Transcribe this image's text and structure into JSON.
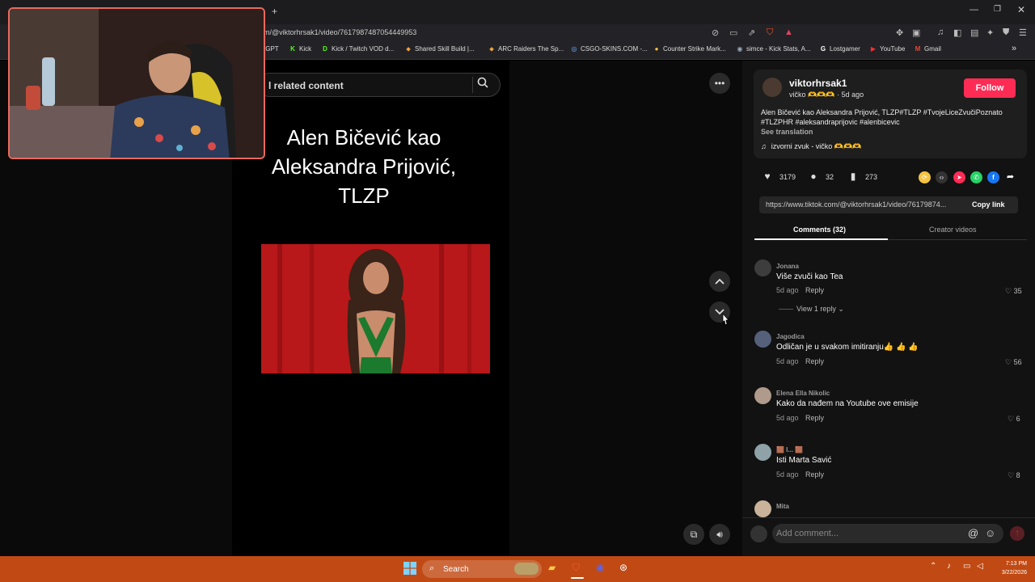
{
  "browser": {
    "new_tab_label": "+",
    "url": "m/@viktorhrsak1/video/7617987487054449953",
    "bookmarks": [
      {
        "label": "tGPT",
        "icon": ""
      },
      {
        "label": "Kick",
        "icon": "K"
      },
      {
        "label": "Kick / Twitch VOD d...",
        "icon": "D"
      },
      {
        "label": "Shared Skill Build |...",
        "icon": "⬥"
      },
      {
        "label": "ARC Raiders The Sp...",
        "icon": "⬥"
      },
      {
        "label": "CSGO-SKINS.COM -...",
        "icon": "◎"
      },
      {
        "label": "Counter Strike Mark...",
        "icon": "●"
      },
      {
        "label": "simce - Kick Stats, A...",
        "icon": "◉"
      },
      {
        "label": "Lostgamer",
        "icon": "G"
      },
      {
        "label": "YouTube",
        "icon": "▶"
      },
      {
        "label": "Gmail",
        "icon": "M"
      }
    ],
    "more_bookmarks": "»"
  },
  "search": {
    "text": "l related content"
  },
  "video": {
    "title": "Alen Bičević kao Aleksandra Prijović, TLZP"
  },
  "post": {
    "username": "viktorhrsak1",
    "display_name": "vičko 🫶🫶🫶",
    "time": "· 5d ago",
    "follow_label": "Follow",
    "caption": "Alen Bičević kao Aleksandra Prijović, TLZP#TLZP #TvojeLiceZvučiPoznato #TLZPHR #aleksandraprijovic #alenbicevic",
    "see_translation": "See translation",
    "sound": "izvorni zvuk - vičko 🫶🫶🫶",
    "likes": "3179",
    "comments": "32",
    "saves": "273",
    "link": "https://www.tiktok.com/@viktorhrsak1/video/76179874...",
    "copy_link": "Copy link"
  },
  "tabs": {
    "comments": "Comments (32)",
    "creator": "Creator videos"
  },
  "comments": [
    {
      "user": "Jonana",
      "text": "Više zvuči kao Tea",
      "time": "5d ago",
      "reply": "Reply",
      "likes": "35",
      "view_replies": "View 1 reply"
    },
    {
      "user": "Jagodica",
      "text": "Odličan je u svakom imitiranju👍 👍 👍",
      "time": "5d ago",
      "reply": "Reply",
      "likes": "56"
    },
    {
      "user": "Elena Ella Nikolic",
      "text": "Kako da nađem na Youtube ove emisije",
      "time": "5d ago",
      "reply": "Reply",
      "likes": "6"
    },
    {
      "user": "🟫 I... 🟫",
      "text": "Isti Marta Savić",
      "time": "5d ago",
      "reply": "Reply",
      "likes": "8"
    },
    {
      "user": "Mita",
      "text": "",
      "time": "",
      "reply": "",
      "likes": ""
    }
  ],
  "comment_box": {
    "placeholder": "Add comment..."
  },
  "taskbar": {
    "search_label": "Search",
    "time": "7:13 PM",
    "date": "3/22/2026"
  },
  "colors": {
    "follow": "#fe2c55",
    "taskbar": "#c14a14",
    "webcam_border": "#e86a5e"
  }
}
